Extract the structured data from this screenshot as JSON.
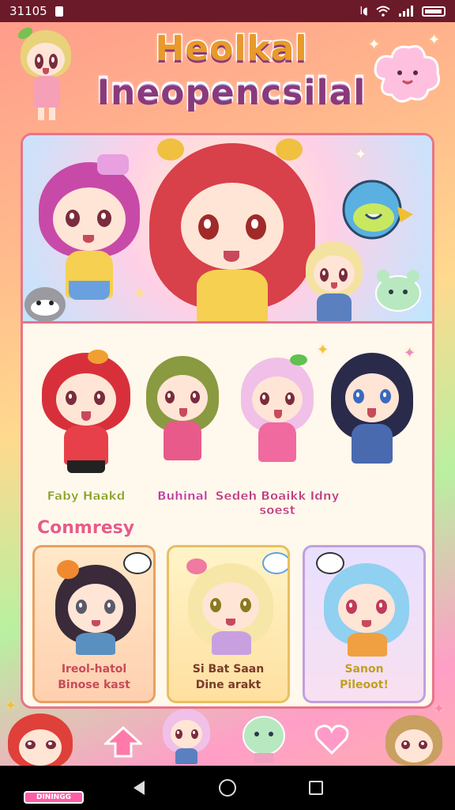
{
  "status_bar": {
    "time": "31105",
    "signal_text": "l◖"
  },
  "title": {
    "line1": "Heolkal",
    "line2": "Ineopencsilal"
  },
  "roster": [
    {
      "name": "Faby Haakd",
      "color": "#8aa020"
    },
    {
      "name": "Buhinal",
      "color": "#c03a9a"
    },
    {
      "name": "Sedeh Boaikk\nIdny soest",
      "color": "#c03a7a"
    }
  ],
  "section": {
    "title": "Conmresy"
  },
  "companions": [
    {
      "caption": "Ireol-hatol\nBinose kast",
      "color": "#c84a5a"
    },
    {
      "caption": "Si Bat Saan\nDine arakt",
      "color": "#7a3a2a"
    },
    {
      "caption": "Sanon\nPileoot!",
      "color": "#c0a020"
    }
  ],
  "banner_tag": "DININGG",
  "colors": {
    "accent": "#e8748a",
    "panel_bg": "#fff8ec",
    "status_bar": "#6b1a2a"
  }
}
